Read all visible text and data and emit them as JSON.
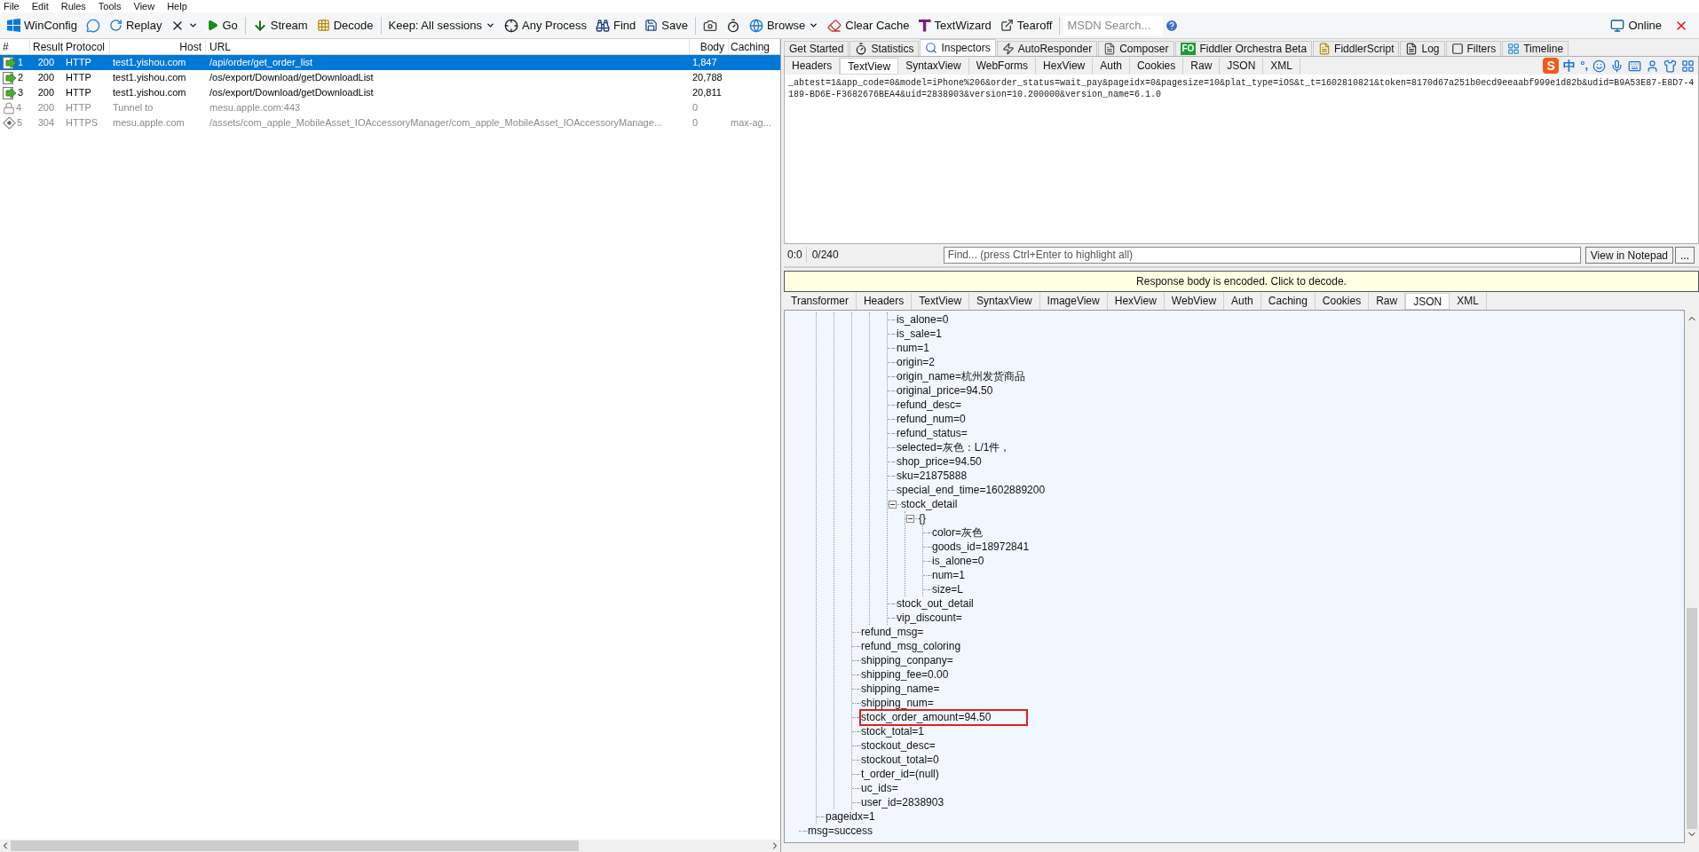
{
  "menu": [
    "File",
    "Edit",
    "Rules",
    "Tools",
    "View",
    "Help"
  ],
  "toolbar": {
    "items": [
      {
        "kind": "windows",
        "label": "WinConfig"
      },
      {
        "kind": "comment"
      },
      {
        "kind": "replay",
        "label": "Replay"
      },
      {
        "kind": "remove",
        "dropdown": true
      },
      {
        "kind": "go",
        "label": "Go"
      },
      {
        "kind": "stream",
        "label": "Stream"
      },
      {
        "kind": "decode",
        "label": "Decode"
      },
      {
        "kind": "keep",
        "label": "Keep: All sessions",
        "dropdown": true
      },
      {
        "kind": "process",
        "label": "Any Process"
      },
      {
        "kind": "find",
        "label": "Find"
      },
      {
        "kind": "save",
        "label": "Save"
      },
      {
        "kind": "camera"
      },
      {
        "kind": "timer"
      },
      {
        "kind": "browse",
        "label": "Browse",
        "dropdown": true
      },
      {
        "kind": "clear",
        "label": "Clear Cache"
      },
      {
        "kind": "wizard",
        "label": "TextWizard"
      },
      {
        "kind": "tearoff",
        "label": "Tearoff"
      }
    ],
    "search": {
      "placeholder": "MSDN Search..."
    },
    "online": "Online"
  },
  "sessions": {
    "columns": [
      "#",
      "Result",
      "Protocol",
      "Host",
      "URL",
      "Body",
      "Caching"
    ],
    "rows": [
      {
        "kind": "request",
        "selected": true,
        "cells": [
          "1",
          "200",
          "HTTP",
          "test1.yishou.com",
          "/api/order/get_order_list",
          "1,847",
          ""
        ]
      },
      {
        "kind": "request",
        "selected": false,
        "cells": [
          "2",
          "200",
          "HTTP",
          "test1.yishou.com",
          "/os/export/Download/getDownloadList",
          "20,788",
          ""
        ]
      },
      {
        "kind": "request",
        "selected": false,
        "cells": [
          "3",
          "200",
          "HTTP",
          "test1.yishou.com",
          "/os/export/Download/getDownloadList",
          "20,811",
          ""
        ]
      },
      {
        "kind": "tunnel",
        "selected": false,
        "cells": [
          "4",
          "200",
          "HTTP",
          "Tunnel to",
          "mesu.apple.com:443",
          "0",
          ""
        ]
      },
      {
        "kind": "not_modified",
        "selected": false,
        "cells": [
          "5",
          "304",
          "HTTPS",
          "mesu.apple.com",
          "/assets/com_apple_MobileAsset_IOAccessoryManager/com_apple_MobileAsset_IOAccessoryManage...",
          "0",
          "max-ag..."
        ]
      }
    ]
  },
  "main_tabs": [
    {
      "label": "Get Started",
      "kind": "plain",
      "selected": false
    },
    {
      "label": "Statistics",
      "kind": "timer",
      "selected": false
    },
    {
      "label": "Inspectors",
      "kind": "inspect",
      "selected": true
    },
    {
      "label": "AutoResponder",
      "kind": "bolt",
      "selected": false
    },
    {
      "label": "Composer",
      "kind": "compose",
      "selected": false
    },
    {
      "label": "Fiddler Orchestra Beta",
      "kind": "orchestra",
      "badge": "FO",
      "selected": false
    },
    {
      "label": "FiddlerScript",
      "kind": "script",
      "selected": false
    },
    {
      "label": "Log",
      "kind": "log",
      "selected": false
    },
    {
      "label": "Filters",
      "kind": "filter",
      "selected": false
    },
    {
      "label": "Timeline",
      "kind": "timeline",
      "selected": false
    }
  ],
  "request": {
    "tabs": [
      {
        "label": "Headers",
        "selected": false
      },
      {
        "label": "TextView",
        "selected": true
      },
      {
        "label": "SyntaxView",
        "selected": false
      },
      {
        "label": "WebForms",
        "selected": false
      },
      {
        "label": "HexView",
        "selected": false
      },
      {
        "label": "Auth",
        "selected": false
      },
      {
        "label": "Cookies",
        "selected": false
      },
      {
        "label": "Raw",
        "selected": false
      },
      {
        "label": "JSON",
        "selected": false
      },
      {
        "label": "XML",
        "selected": false
      }
    ],
    "ime": {
      "logo": "S",
      "lang": "中",
      "punct": "°,"
    },
    "body": "_abtest=1&app_code=0&model=iPhone%206&order_status=wait_pay&pageidx=0&pagesize=10&plat_type=iOS&t_t=1602810821&token=8170d67a251b0ecd9eeaabf999e1d82b&udid=B9A53E87-E8D7-4189-BD6E-F3682676BEA4&uid=2838903&version=10.200000&version_name=6.1.0",
    "position": "0:0",
    "count": "0/240",
    "find": {
      "placeholder": "Find... (press Ctrl+Enter to highlight all)"
    },
    "notepad": "View in Notepad",
    "more": "..."
  },
  "response": {
    "notice": "Response body is encoded. Click to decode.",
    "tabs": [
      {
        "label": "Transformer",
        "selected": false
      },
      {
        "label": "Headers",
        "selected": false
      },
      {
        "label": "TextView",
        "selected": false
      },
      {
        "label": "SyntaxView",
        "selected": false
      },
      {
        "label": "ImageView",
        "selected": false
      },
      {
        "label": "HexView",
        "selected": false
      },
      {
        "label": "WebView",
        "selected": false
      },
      {
        "label": "Auth",
        "selected": false
      },
      {
        "label": "Caching",
        "selected": false
      },
      {
        "label": "Cookies",
        "selected": false
      },
      {
        "label": "Raw",
        "selected": false
      },
      {
        "label": "JSON",
        "selected": true
      },
      {
        "label": "XML",
        "selected": false
      }
    ],
    "tree": [
      {
        "children": [
          {
            "children": [
              {
                "children": [
                  {
                    "children": [
                      {
                        "children": [
                          {
                            "label": "is_alone=0"
                          },
                          {
                            "label": "is_sale=1"
                          },
                          {
                            "label": "num=1"
                          },
                          {
                            "label": "origin=2"
                          },
                          {
                            "label": "origin_name=杭州发货商品"
                          },
                          {
                            "label": "original_price=94.50"
                          },
                          {
                            "label": "refund_desc="
                          },
                          {
                            "label": "refund_num=0"
                          },
                          {
                            "label": "refund_status="
                          },
                          {
                            "label": "selected=灰色：L/1件，"
                          },
                          {
                            "label": "shop_price=94.50"
                          },
                          {
                            "label": "sku=21875888"
                          },
                          {
                            "label": "special_end_time=1602889200"
                          },
                          {
                            "label": "stock_detail",
                            "expanded": true,
                            "children": [
                              {
                                "label": "{}",
                                "expanded": true,
                                "children": [
                                  {
                                    "label": "color=灰色"
                                  },
                                  {
                                    "label": "goods_id=18972841"
                                  },
                                  {
                                    "label": "is_alone=0"
                                  },
                                  {
                                    "label": "num=1"
                                  },
                                  {
                                    "label": "size=L"
                                  }
                                ]
                              }
                            ]
                          },
                          {
                            "label": "stock_out_detail"
                          },
                          {
                            "label": "vip_discount="
                          }
                        ]
                      }
                    ]
                  },
                  {
                    "label": "refund_msg="
                  },
                  {
                    "label": "refund_msg_coloring"
                  },
                  {
                    "label": "shipping_conpany="
                  },
                  {
                    "label": "shipping_fee=0.00"
                  },
                  {
                    "label": "shipping_name="
                  },
                  {
                    "label": "shipping_num="
                  },
                  {
                    "label": "stock_order_amount=94.50",
                    "highlighted": true
                  },
                  {
                    "label": "stock_total=1"
                  },
                  {
                    "label": "stockout_desc="
                  },
                  {
                    "label": "stockout_total=0"
                  },
                  {
                    "label": "t_order_id=(null)"
                  },
                  {
                    "label": "uc_ids="
                  },
                  {
                    "label": "user_id=2838903"
                  }
                ]
              }
            ]
          },
          {
            "label": "pageidx=1"
          }
        ]
      },
      {
        "label": "msg=success"
      }
    ]
  }
}
